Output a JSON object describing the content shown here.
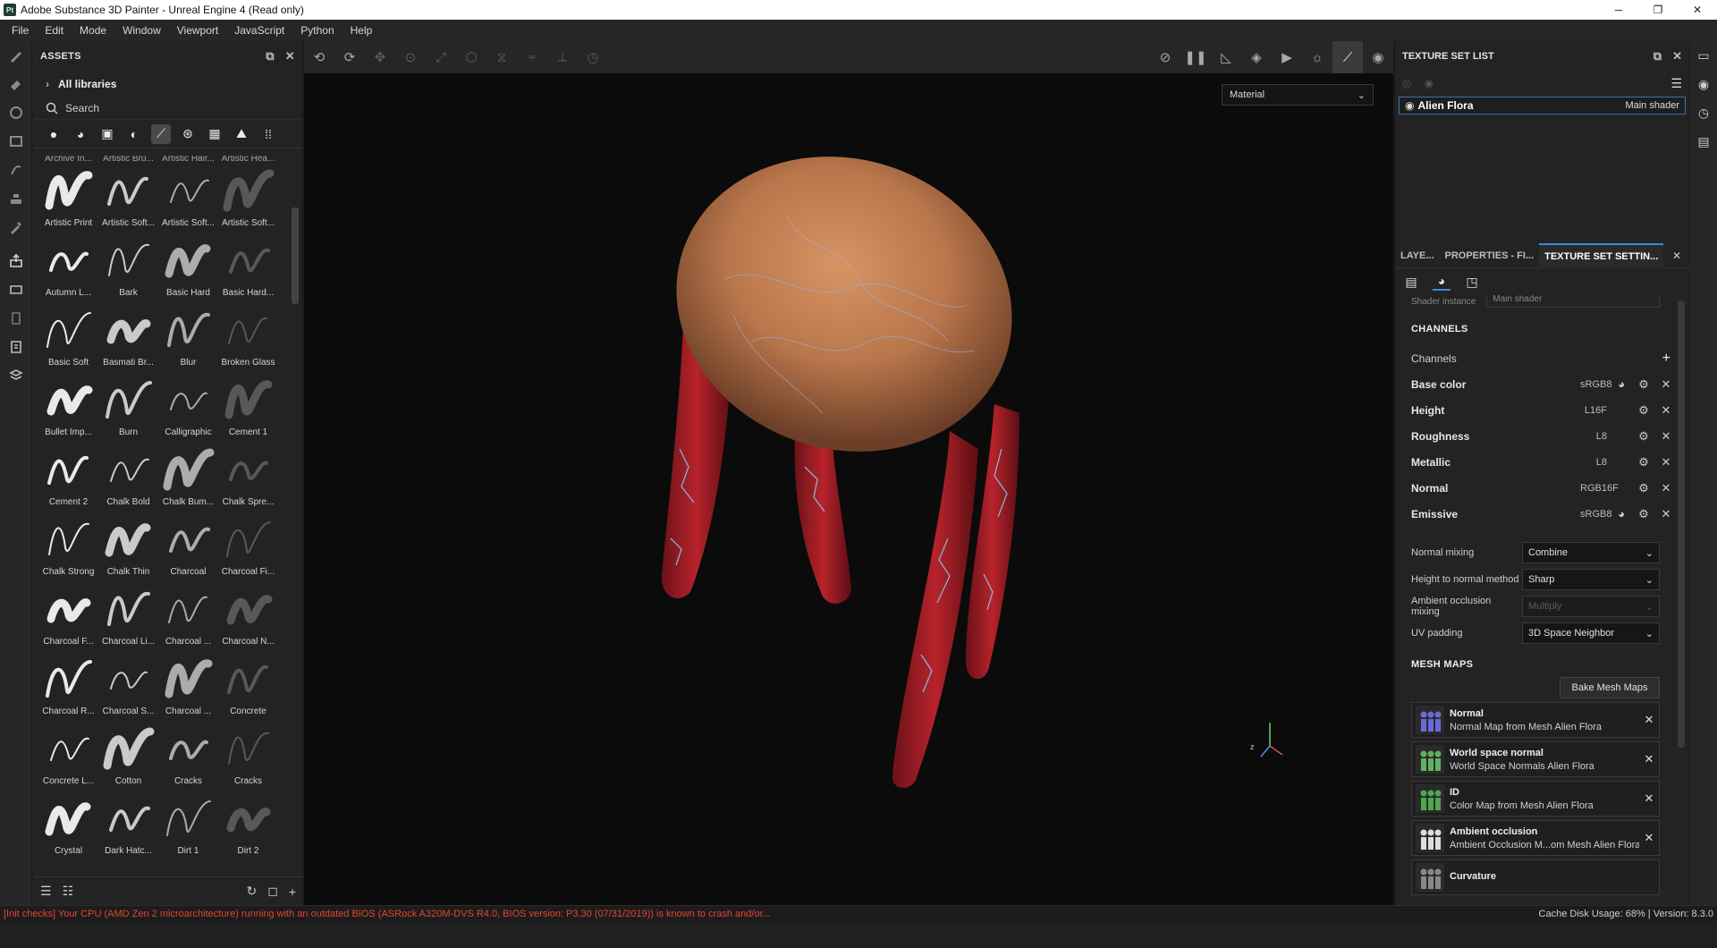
{
  "window": {
    "logo_text": "Pt",
    "title": "Adobe Substance 3D Painter - Unreal Engine 4 (Read only)",
    "minimize": "─",
    "maximize": "❐",
    "close": "✕"
  },
  "menu": [
    "File",
    "Edit",
    "Mode",
    "Window",
    "Viewport",
    "JavaScript",
    "Python",
    "Help"
  ],
  "assets": {
    "title": "ASSETS",
    "library": "All libraries",
    "search_placeholder": "Search",
    "top_cut_labels": [
      "Archive In...",
      "Artistic Bru...",
      "Artistic Hair...",
      "Artistic Hea..."
    ],
    "items": [
      "Artistic Print",
      "Artistic Soft...",
      "Artistic Soft...",
      "Artistic Soft...",
      "Autumn L...",
      "Bark",
      "Basic Hard",
      "Basic Hard...",
      "Basic Soft",
      "Basmati Br...",
      "Blur",
      "Broken Glass",
      "Bullet Imp...",
      "Burn",
      "Calligraphic",
      "Cement 1",
      "Cement 2",
      "Chalk Bold",
      "Chalk Bum...",
      "Chalk Spre...",
      "Chalk Strong",
      "Chalk Thin",
      "Charcoal",
      "Charcoal Fi...",
      "Charcoal F...",
      "Charcoal Li...",
      "Charcoal ...",
      "Charcoal N...",
      "Charcoal R...",
      "Charcoal S...",
      "Charcoal ...",
      "Concrete",
      "Concrete L...",
      "Cotton",
      "Cracks",
      "Cracks",
      "Crystal",
      "Dark Hatc...",
      "Dirt 1",
      "Dirt 2"
    ]
  },
  "viewport": {
    "material_mode": "Material"
  },
  "texture_set_list": {
    "title": "TEXTURE SET LIST",
    "item_name": "Alien Flora",
    "item_shader": "Main shader"
  },
  "tabs": [
    "LAYE...",
    "PROPERTIES - FI...",
    "TEXTURE SET SETTIN..."
  ],
  "texture_settings": {
    "cut_label": "Shader instance",
    "cut_value": "Main shader",
    "channels_title": "CHANNELS",
    "channels_label": "Channels",
    "channels": [
      {
        "name": "Base color",
        "format": "sRGB8",
        "srgb": true
      },
      {
        "name": "Height",
        "format": "L16F",
        "srgb": false
      },
      {
        "name": "Roughness",
        "format": "L8",
        "srgb": false
      },
      {
        "name": "Metallic",
        "format": "L8",
        "srgb": false
      },
      {
        "name": "Normal",
        "format": "RGB16F",
        "srgb": false
      },
      {
        "name": "Emissive",
        "format": "sRGB8",
        "srgb": true
      }
    ],
    "options": [
      {
        "label": "Normal mixing",
        "value": "Combine",
        "disabled": false
      },
      {
        "label": "Height to normal method",
        "value": "Sharp",
        "disabled": false
      },
      {
        "label": "Ambient occlusion mixing",
        "value": "Multiply",
        "disabled": true
      },
      {
        "label": "UV padding",
        "value": "3D Space Neighbor",
        "disabled": false
      }
    ],
    "mesh_maps_title": "MESH MAPS",
    "bake_button": "Bake Mesh Maps",
    "mesh_maps": [
      {
        "title": "Normal",
        "sub": "Normal Map from Mesh Alien Flora",
        "color": "#6a6ad8"
      },
      {
        "title": "World space normal",
        "sub": "World Space Normals Alien Flora",
        "color": "#5fb35f"
      },
      {
        "title": "ID",
        "sub": "Color Map from Mesh Alien Flora",
        "color": "#4ea84e"
      },
      {
        "title": "Ambient occlusion",
        "sub": "Ambient Occlusion M...om Mesh Alien Flora",
        "color": "#dddddd"
      },
      {
        "title": "Curvature",
        "sub": "",
        "color": "#888888"
      }
    ]
  },
  "status": {
    "message": "[Init checks] Your CPU (AMD Zen 2 microarchitecture) running with an outdated BIOS (ASRock A320M-DVS R4.0, BIOS version: P3.30 (07/31/2019)) is known to crash and/or...",
    "cache": "Cache Disk Usage:   68% | Version: 8.3.0"
  },
  "colors": {
    "accent": "#3d89d8",
    "error": "#e2452f",
    "body_orange": "#c97b4a",
    "legs_red": "#b8232b"
  }
}
